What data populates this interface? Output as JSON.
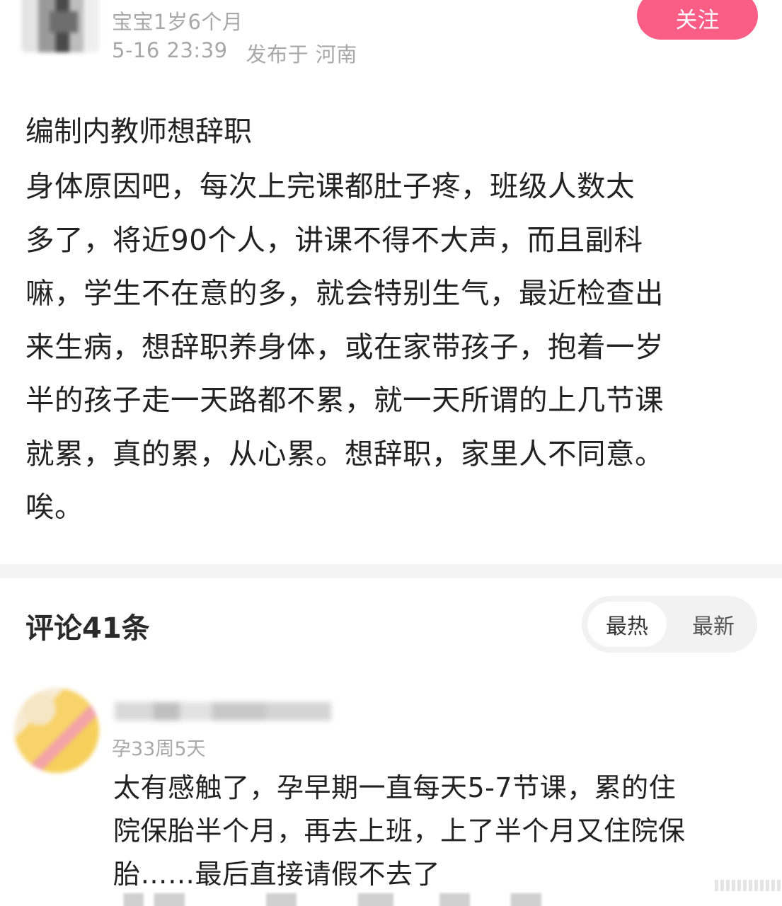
{
  "post": {
    "author_meta": "宝宝1岁6个月",
    "timestamp": "5-16 23:39",
    "location": "发布于 河南",
    "follow_label": "关注",
    "title": "编制内教师想辞职",
    "body_lines": [
      "身体原因吧，每次上完课都肚子疼，班级人数太",
      "多了，将近90个人，讲课不得不大声，而且副科",
      "嘛，学生不在意的多，就会特别生气，最近检查出",
      "来生病，想辞职养身体，或在家带孩子，抱着一岁",
      "半的孩子走一天路都不累，就一天所谓的上几节课",
      "就累，真的累，从心累。想辞职，家里人不同意。",
      "唉。"
    ]
  },
  "comments": {
    "title": "评论41条",
    "sort_hot": "最热",
    "sort_new": "最新",
    "items": [
      {
        "meta": "孕33周5天",
        "body_lines": [
          "太有感触了，孕早期一直每天5-7节课，累的住",
          "院保胎半个月，再去上班，上了半个月又住院保",
          "胎……最后直接请假不去了"
        ]
      }
    ]
  },
  "colors": {
    "accent": "#fa5d86",
    "meta_gray": "#a8a8a8",
    "text": "#222222",
    "divider": "#f4f4f4"
  }
}
